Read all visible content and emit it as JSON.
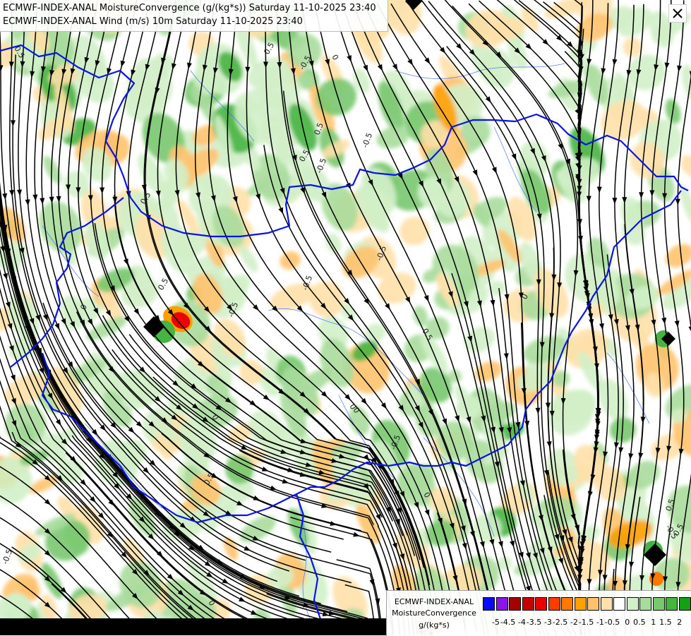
{
  "header": {
    "line1": "ECMWF-INDEX-ANAL MoistureConvergence (g/(kg*s)) Saturday 11-10-2025 23:40",
    "line2": "ECMWF-INDEX-ANAL Wind (m/s) 10m Saturday 11-10-2025 23:40"
  },
  "legend": {
    "line1": "ECMWF-INDEX-ANAL",
    "line2": "MoistureConvergence",
    "line3": "g/(kg*s)",
    "colors": [
      "#0a0aff",
      "#8b14e6",
      "#a40000",
      "#c80000",
      "#ec0000",
      "#ff3c00",
      "#ff7800",
      "#ffa000",
      "#ffc36e",
      "#ffe0a8",
      "#ffffff",
      "#d2f0c8",
      "#a8dc9c",
      "#78c86e",
      "#46b441",
      "#14a014"
    ],
    "ticks": [
      "-5",
      "-4.5",
      "-4",
      "-3.5",
      "-3",
      "-2.5",
      "-2",
      "-1.5",
      "-1",
      "-0.5",
      "0",
      "0.5",
      "1",
      "1.5",
      "2"
    ]
  },
  "contour_labels": [
    "0.5",
    "-0.5",
    "0",
    "-0.5",
    "0.5",
    "0",
    "0.5",
    "-0.5",
    "0",
    "0.5",
    "-0.5",
    "0",
    "0.5",
    "-0.5",
    "0.5",
    "0",
    "-0.5",
    "0.5",
    "0",
    "0.5",
    "-0.5",
    "0.5",
    "-0.5",
    "0",
    "0.5",
    "-0.5",
    "0"
  ]
}
